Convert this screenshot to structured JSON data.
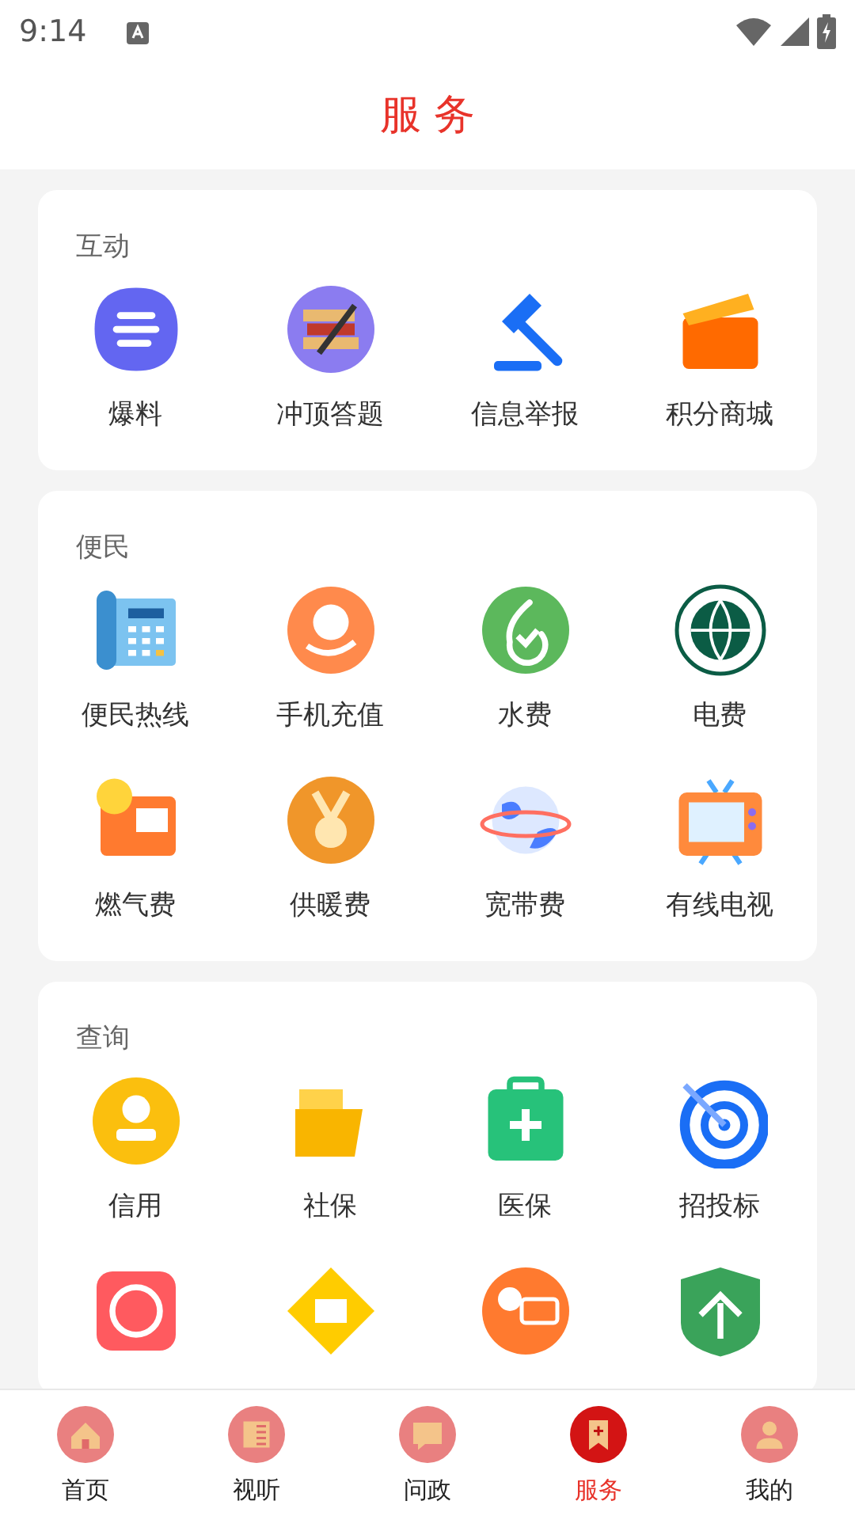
{
  "status_bar": {
    "time": "9:14"
  },
  "header": {
    "title": "服 务"
  },
  "sections": [
    {
      "title": "互动",
      "items": [
        {
          "label": "爆料"
        },
        {
          "label": "冲顶答题"
        },
        {
          "label": "信息举报"
        },
        {
          "label": "积分商城"
        }
      ]
    },
    {
      "title": "便民",
      "items": [
        {
          "label": "便民热线"
        },
        {
          "label": "手机充值"
        },
        {
          "label": "水费"
        },
        {
          "label": "电费"
        },
        {
          "label": "燃气费"
        },
        {
          "label": "供暖费"
        },
        {
          "label": "宽带费"
        },
        {
          "label": "有线电视"
        }
      ]
    },
    {
      "title": "查询",
      "items": [
        {
          "label": "信用"
        },
        {
          "label": "社保"
        },
        {
          "label": "医保"
        },
        {
          "label": "招投标"
        },
        {
          "kind": "icon_only"
        },
        {
          "kind": "icon_only"
        },
        {
          "kind": "icon_only"
        },
        {
          "kind": "icon_only"
        }
      ]
    }
  ],
  "tab_bar": [
    {
      "label": "首页",
      "selected": false
    },
    {
      "label": "视听",
      "selected": false
    },
    {
      "label": "问政",
      "selected": false
    },
    {
      "label": "服务",
      "selected": true
    },
    {
      "label": "我的",
      "selected": false
    }
  ]
}
